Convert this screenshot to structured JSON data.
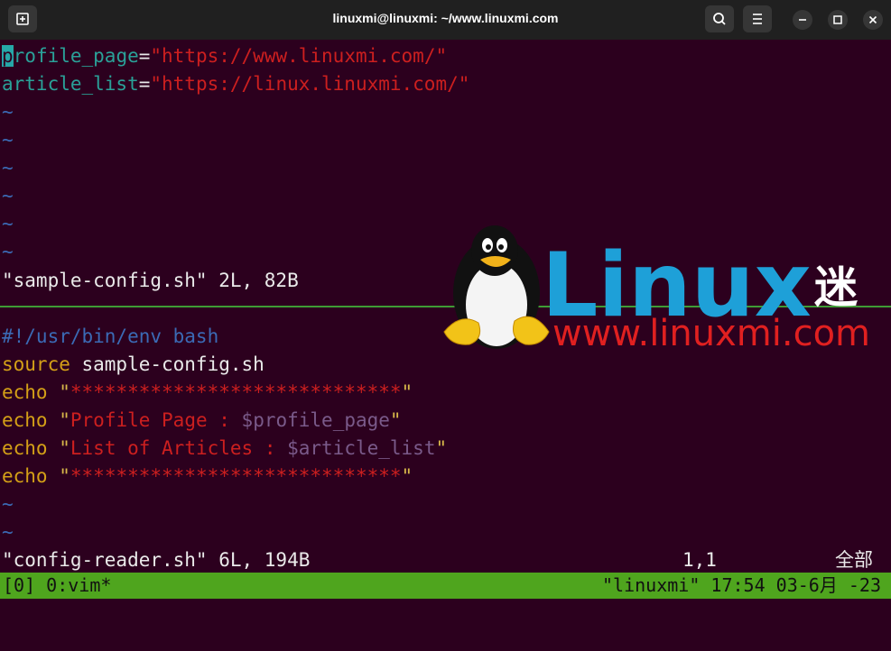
{
  "window": {
    "title": "linuxmi@linuxmi: ~/www.linuxmi.com"
  },
  "top_pane": {
    "lines": [
      {
        "var": "profile_page",
        "op": "=",
        "str": "\"https://www.linuxmi.com/\""
      },
      {
        "var": "article_list",
        "op": "=",
        "str": "\"https://linux.linuxmi.com/\""
      }
    ],
    "tilde": "~",
    "status": "\"sample-config.sh\" 2L, 82B"
  },
  "bottom_pane": {
    "shebang": "#!/usr/bin/env bash",
    "source_kw": "source",
    "source_arg": " sample-config.sh",
    "echo_kw": "echo",
    "echo1": "\"*****************************\"",
    "echo2_q": "\"",
    "echo2_text": "Profile Page : ",
    "echo2_var": "$profile_page",
    "echo3_text": "List of Articles : ",
    "echo3_var": "$article_list",
    "echo4": "\"*****************************\"",
    "status_file": "\"config-reader.sh\" 6L, 194B",
    "status_pos": "1,1",
    "status_all": "全部"
  },
  "tmux": {
    "left": "[0] 0:vim*",
    "right": "\"linuxmi\" 17:54 03-6月 -23"
  },
  "watermark": {
    "logo_text": "Linux",
    "logo_char": "迷",
    "url": "www.linuxmi.com",
    "colors": {
      "logo": "#1ea0d8",
      "url": "#e02020"
    }
  }
}
